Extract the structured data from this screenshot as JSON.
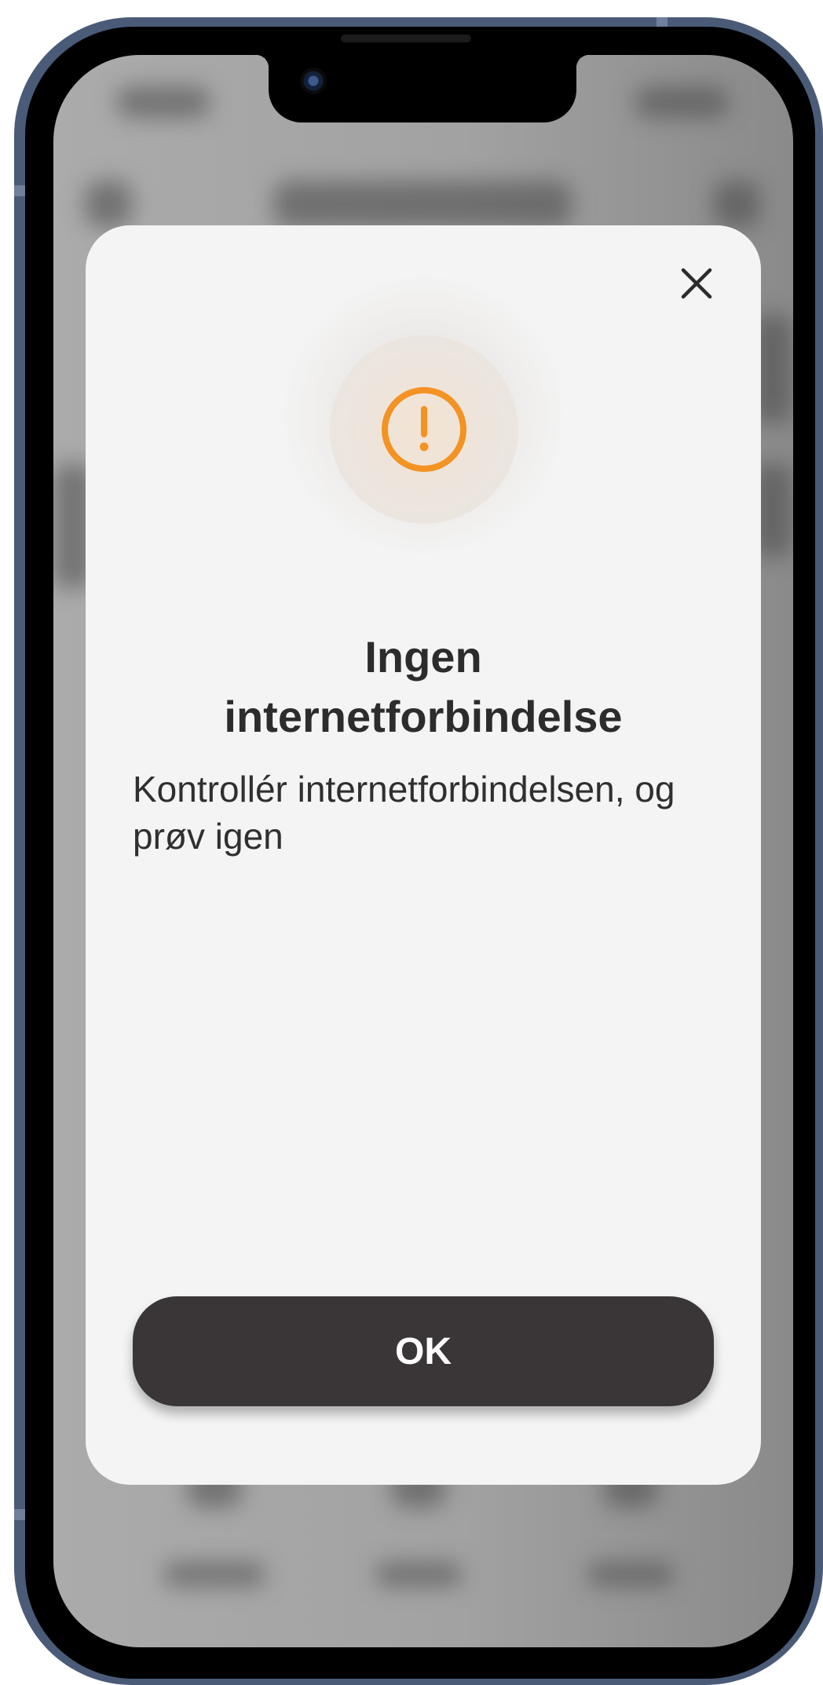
{
  "dialog": {
    "title_line1": "Ingen",
    "title_line2": "internetforbindelse",
    "message_line1": "Kontrollér internetforbindelsen, og",
    "message_line2": "prøv igen",
    "ok_label": "OK",
    "close_icon": "close-icon",
    "alert_icon": "exclamation-circle-icon"
  },
  "colors": {
    "accent": "#F39324",
    "button_bg": "#3A3536",
    "dialog_bg": "#F4F4F4",
    "frame": "#4A5B78"
  }
}
